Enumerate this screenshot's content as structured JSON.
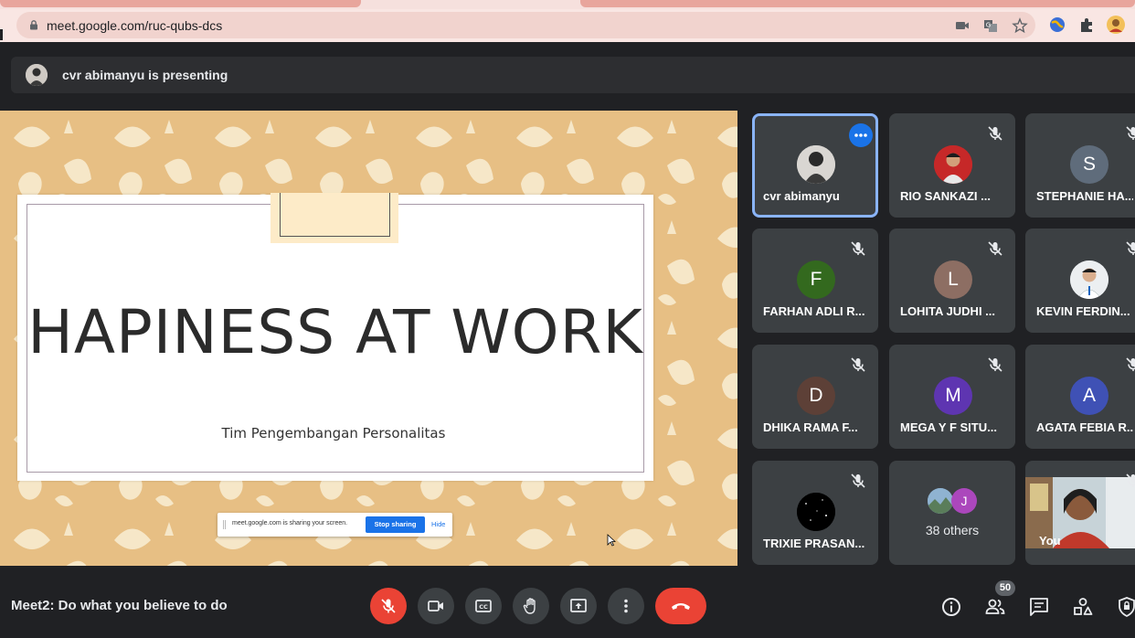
{
  "browser": {
    "url": "meet.google.com/ruc-qubs-dcs"
  },
  "presenting": {
    "text": "cvr abimanyu is presenting"
  },
  "slide": {
    "title": "HAPINESS AT WORK",
    "subtitle": "Tim Pengembangan Personalitas"
  },
  "share_notice": {
    "text": "meet.google.com is sharing your screen.",
    "stop_label": "Stop sharing",
    "hide_label": "Hide"
  },
  "participants": [
    {
      "name": "cvr abimanyu",
      "initial": "",
      "color": "#d9d6d2",
      "photo": true
    },
    {
      "name": "RIO SANKAZI ...",
      "initial": "",
      "color": "#c62828",
      "photo": true
    },
    {
      "name": "STEPHANIE HA...",
      "initial": "S",
      "color": "#5f6c7b"
    },
    {
      "name": "FARHAN ADLI R...",
      "initial": "F",
      "color": "#33691e"
    },
    {
      "name": "LOHITA JUDHI ...",
      "initial": "L",
      "color": "#8d6e63"
    },
    {
      "name": "KEVIN FERDIN...",
      "initial": "",
      "color": "#e3e6ea",
      "photo": true
    },
    {
      "name": "DHIKA RAMA F...",
      "initial": "D",
      "color": "#5d4037"
    },
    {
      "name": "MEGA Y F SITU...",
      "initial": "M",
      "color": "#5e35b1"
    },
    {
      "name": "AGATA FEBIA R...",
      "initial": "A",
      "color": "#3f51b5"
    },
    {
      "name": "TRIXIE PRASAN...",
      "initial": "",
      "color": "#000000",
      "photo": true
    }
  ],
  "others": {
    "label": "38 others",
    "initial": "J",
    "color": "#ab47bc"
  },
  "self": {
    "label": "You"
  },
  "meeting": {
    "title": "Meet2: Do what you believe to do"
  },
  "people_count": "50",
  "colors": {
    "background": "#202124",
    "tile": "#3c4043",
    "accent": "#1a73e8",
    "danger": "#ea4335",
    "slide_bg": "#e7bf84"
  }
}
